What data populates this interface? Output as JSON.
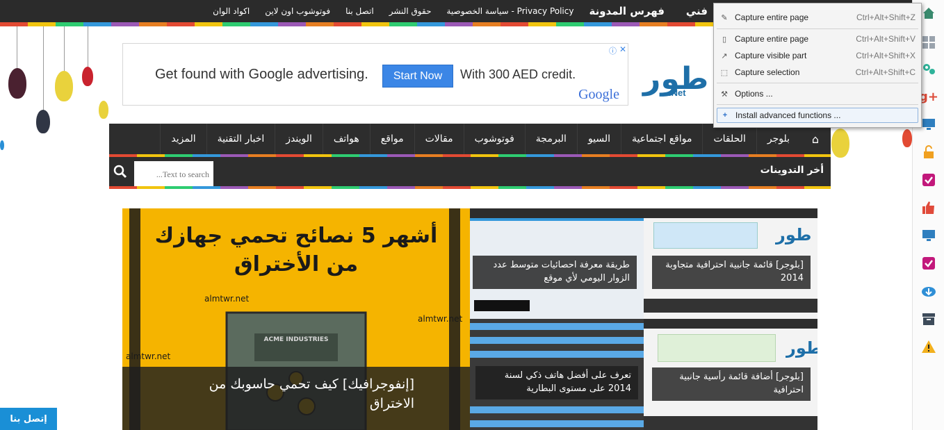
{
  "topbar": {
    "links": [
      {
        "label": "فني",
        "big": true,
        "clip": true
      },
      {
        "label": "فهرس المدونة",
        "big": true
      },
      {
        "label": "سياسة الخصوصية - Privacy Policy"
      },
      {
        "label": "حقوق النشر"
      },
      {
        "label": "اتصل بنا"
      },
      {
        "label": "فوتوشوب اون لاين"
      },
      {
        "label": "اكواد الوان"
      }
    ]
  },
  "ad": {
    "text": "Get found with Google advertising.",
    "button": "Start Now",
    "text2": "With 300 AED  credit.",
    "brand": "Google"
  },
  "logo": {
    "text": "طور",
    "suffix": ".Net"
  },
  "nav": {
    "items": [
      "بلوجر",
      "الحلقات",
      "مواقع اجتماعية",
      "السيو",
      "البرمجة",
      "فوتوشوب",
      "مقالات",
      "مواقع",
      "هواتف",
      "الويندز",
      "اخبار التقنية",
      "المزيد"
    ]
  },
  "latest": {
    "title": "أخر التدوينات",
    "search_placeholder": "Text to search..."
  },
  "featured": {
    "big_image_title": "أشهر 5 نصائح تحمي جهازك من الأختراق",
    "big_image_watermark": "almtwr.net",
    "big_image_box": "ACME INDUSTRIES",
    "big_caption": "[إنفوجرافيك] كيف تحمي حاسوبك من الاختراق",
    "posts": [
      {
        "caption": "طريقة معرفة احصائيات متوسط عدد الزوار اليومي لأي موقع"
      },
      {
        "caption": "[بلوجر] قائمة جانبية احترافية متجاوبة 2014"
      },
      {
        "caption": "تعرف على أفضل هاتف ذكي لسنة 2014 على مستوى البطارية"
      },
      {
        "caption": "[بلوجر] أضافة قائمة رأسية جانبية احترافية"
      }
    ]
  },
  "contact": {
    "label": "إتصل بنا"
  },
  "menu": {
    "items": [
      {
        "label": "Capture entire page",
        "shortcut": "Ctrl+Alt+Shift+Z",
        "icon": "pen-icon"
      },
      {
        "label": "Capture entire page",
        "shortcut": "Ctrl+Alt+Shift+V",
        "icon": "page-icon"
      },
      {
        "label": "Capture visible part",
        "shortcut": "Ctrl+Alt+Shift+X",
        "icon": "visible-icon"
      },
      {
        "label": "Capture selection",
        "shortcut": "Ctrl+Alt+Shift+C",
        "icon": "selection-icon"
      },
      {
        "label": "Options ...",
        "shortcut": "",
        "icon": "wrench-icon"
      },
      {
        "label": "Install advanced functions ...",
        "shortcut": "",
        "icon": "plus-icon"
      }
    ]
  },
  "colors": {
    "accent": "#1a8fd6",
    "nav": "#2d2d2d",
    "adButton": "#3b86e6",
    "featured": "#f5b400"
  }
}
